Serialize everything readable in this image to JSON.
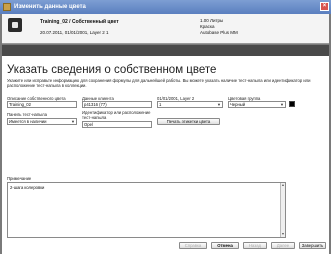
{
  "window": {
    "title": "Изменить данные цвета"
  },
  "header": {
    "title": "Training_02 / Собственный цвет",
    "subtitle": "20.07.2011, 01/01/2001, Layer 2 1",
    "right": [
      "1.00 Литры",
      "Краска",
      "Autobase Plus MM"
    ]
  },
  "page": {
    "title": "Указать сведения о собственном цвете",
    "intro": "Укажите или исправьте информацию для сохранения формулы для дальнейшей работы. Вы можете указать наличие тест-напыла или идентификатор или расположение тест-напыла в коллекции."
  },
  "form": {
    "color_desc_label": "Описание собственного цвета",
    "color_desc_value": "Training_02",
    "customer_data_label": "Данные клиента",
    "customer_data_value": "p41316 (77)",
    "date_layer_label": "01/01/2001, Layer 2",
    "date_layer_value": "1",
    "color_group_label": "Цветовая группа",
    "color_group_value": "Черный",
    "spray_panel_label": "Панель тест-напыла",
    "spray_panel_value": "Имеется в наличии",
    "spray_id_label": "Идентификатор или расположение тест-напыла",
    "spray_id_value": "Opel",
    "print_button": "Печать этикетки цвета",
    "notes_label": "Примечание",
    "notes_value": "2-шагa колеровки"
  },
  "footer": {
    "buttons": [
      "Справка",
      "Отмена",
      "Назад",
      "Далее",
      "Завершить"
    ]
  },
  "colors": {
    "title_bar": "#5a7fbf",
    "swatch": "#000000"
  }
}
